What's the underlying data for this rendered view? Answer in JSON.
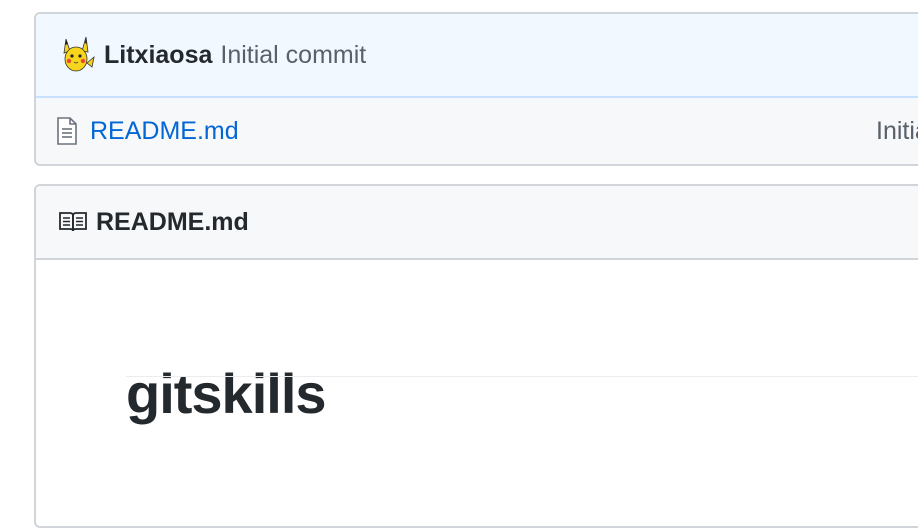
{
  "commit": {
    "author": "Litxiaosa",
    "message": "Initial commit"
  },
  "files": [
    {
      "name": "README.md",
      "commit_message": "Initial commit",
      "icon": "file-text-icon"
    }
  ],
  "readme": {
    "header_title": "README.md",
    "header_icon": "book-icon",
    "heading": "gitskills"
  },
  "colors": {
    "link": "#0366d6",
    "commit_bar_bg": "#f1f8ff",
    "commit_bar_border": "#c8e1ff",
    "box_border": "#d1d5da",
    "header_bg": "#f6f8fa",
    "text": "#24292e",
    "muted": "#586069"
  }
}
